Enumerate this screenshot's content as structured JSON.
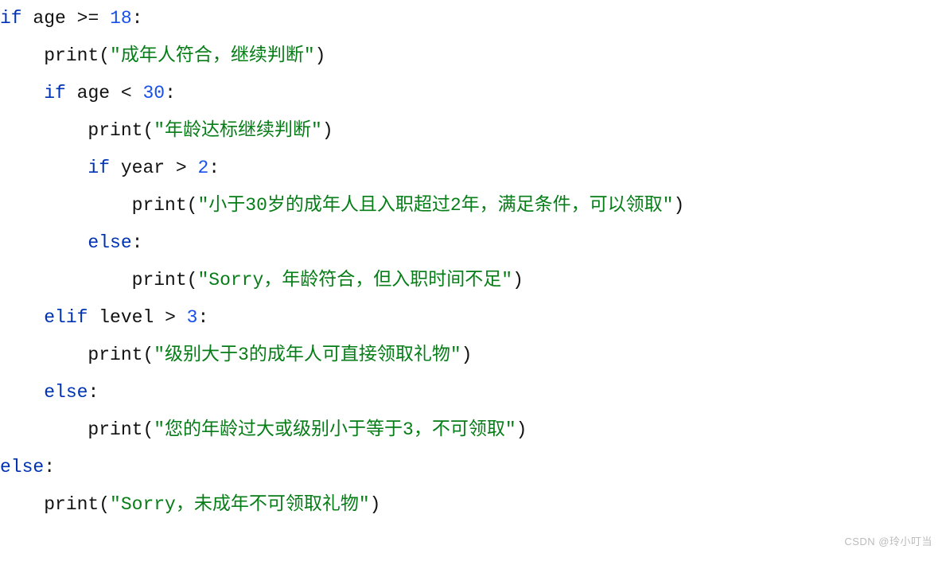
{
  "code": {
    "lines": [
      {
        "indent": 0,
        "tokens": [
          {
            "t": "kw",
            "v": "if "
          },
          {
            "t": "ident",
            "v": "age "
          },
          {
            "t": "op",
            "v": ">= "
          },
          {
            "t": "num",
            "v": "18"
          },
          {
            "t": "colon",
            "v": ":"
          }
        ]
      },
      {
        "indent": 1,
        "tokens": [
          {
            "t": "func",
            "v": "print"
          },
          {
            "t": "paren",
            "v": "("
          },
          {
            "t": "str",
            "v": "\"成年人符合，继续判断\""
          },
          {
            "t": "paren",
            "v": ")"
          }
        ]
      },
      {
        "indent": 1,
        "tokens": [
          {
            "t": "kw",
            "v": "if "
          },
          {
            "t": "ident",
            "v": "age "
          },
          {
            "t": "op",
            "v": "< "
          },
          {
            "t": "num",
            "v": "30"
          },
          {
            "t": "colon",
            "v": ":"
          }
        ]
      },
      {
        "indent": 2,
        "tokens": [
          {
            "t": "func",
            "v": "print"
          },
          {
            "t": "paren",
            "v": "("
          },
          {
            "t": "str",
            "v": "\"年龄达标继续判断\""
          },
          {
            "t": "paren",
            "v": ")"
          }
        ]
      },
      {
        "indent": 2,
        "tokens": [
          {
            "t": "kw",
            "v": "if "
          },
          {
            "t": "ident",
            "v": "year "
          },
          {
            "t": "op",
            "v": "> "
          },
          {
            "t": "num",
            "v": "2"
          },
          {
            "t": "colon",
            "v": ":"
          }
        ]
      },
      {
        "indent": 3,
        "tokens": [
          {
            "t": "func",
            "v": "print"
          },
          {
            "t": "paren",
            "v": "("
          },
          {
            "t": "str",
            "v": "\"小于30岁的成年人且入职超过2年，满足条件，可以领取\""
          },
          {
            "t": "paren",
            "v": ")"
          }
        ]
      },
      {
        "indent": 2,
        "tokens": [
          {
            "t": "kw",
            "v": "else"
          },
          {
            "t": "colon",
            "v": ":"
          }
        ]
      },
      {
        "indent": 3,
        "tokens": [
          {
            "t": "func",
            "v": "print"
          },
          {
            "t": "paren",
            "v": "("
          },
          {
            "t": "str",
            "v": "\"Sorry，年龄符合，但入职时间不足\""
          },
          {
            "t": "paren",
            "v": ")"
          }
        ]
      },
      {
        "indent": 1,
        "tokens": [
          {
            "t": "kw",
            "v": "elif "
          },
          {
            "t": "ident",
            "v": "level "
          },
          {
            "t": "op",
            "v": "> "
          },
          {
            "t": "num",
            "v": "3"
          },
          {
            "t": "colon",
            "v": ":"
          }
        ]
      },
      {
        "indent": 2,
        "tokens": [
          {
            "t": "func",
            "v": "print"
          },
          {
            "t": "paren",
            "v": "("
          },
          {
            "t": "str",
            "v": "\"级别大于3的成年人可直接领取礼物\""
          },
          {
            "t": "paren",
            "v": ")"
          }
        ]
      },
      {
        "indent": 1,
        "tokens": [
          {
            "t": "kw",
            "v": "else"
          },
          {
            "t": "colon",
            "v": ":"
          }
        ]
      },
      {
        "indent": 2,
        "tokens": [
          {
            "t": "func",
            "v": "print"
          },
          {
            "t": "paren",
            "v": "("
          },
          {
            "t": "str",
            "v": "\"您的年龄过大或级别小于等于3，不可领取\""
          },
          {
            "t": "paren",
            "v": ")"
          }
        ]
      },
      {
        "indent": 0,
        "tokens": [
          {
            "t": "kw",
            "v": "else"
          },
          {
            "t": "colon",
            "v": ":"
          }
        ]
      },
      {
        "indent": 1,
        "tokens": [
          {
            "t": "func",
            "v": "print"
          },
          {
            "t": "paren",
            "v": "("
          },
          {
            "t": "str",
            "v": "\"Sorry，未成年不可领取礼物\""
          },
          {
            "t": "paren",
            "v": ")"
          }
        ]
      }
    ]
  },
  "watermark": "CSDN @玲小叮当"
}
